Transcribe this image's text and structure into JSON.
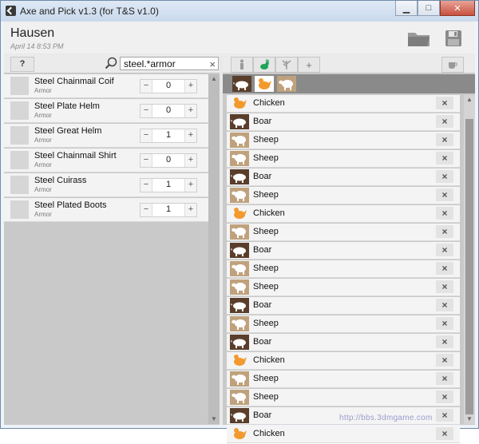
{
  "window": {
    "title": "Axe and Pick v1.3 (for T&S v1.0)"
  },
  "header": {
    "settlement": "Hausen",
    "date": "April 14 8:53 PM"
  },
  "left_toolbar": {
    "help_label": "?",
    "search_value": "steel.*armor",
    "clear_label": "×"
  },
  "items": [
    {
      "name": "Steel Chainmail Coif",
      "category": "Armor",
      "qty": "0"
    },
    {
      "name": "Steel Plate Helm",
      "category": "Armor",
      "qty": "0"
    },
    {
      "name": "Steel Great Helm",
      "category": "Armor",
      "qty": "1"
    },
    {
      "name": "Steel Chainmail Shirt",
      "category": "Armor",
      "qty": "0"
    },
    {
      "name": "Steel Cuirass",
      "category": "Armor",
      "qty": "1"
    },
    {
      "name": "Steel Plated Boots",
      "category": "Armor",
      "qty": "1"
    }
  ],
  "stepper": {
    "minus": "−",
    "plus": "+"
  },
  "right_toolbar": {
    "add_label": "+"
  },
  "animals": [
    {
      "kind": "chicken",
      "name": "Chicken"
    },
    {
      "kind": "boar",
      "name": "Boar"
    },
    {
      "kind": "sheep",
      "name": "Sheep"
    },
    {
      "kind": "sheep",
      "name": "Sheep"
    },
    {
      "kind": "boar",
      "name": "Boar"
    },
    {
      "kind": "sheep",
      "name": "Sheep"
    },
    {
      "kind": "chicken",
      "name": "Chicken"
    },
    {
      "kind": "sheep",
      "name": "Sheep"
    },
    {
      "kind": "boar",
      "name": "Boar"
    },
    {
      "kind": "sheep",
      "name": "Sheep"
    },
    {
      "kind": "sheep",
      "name": "Sheep"
    },
    {
      "kind": "boar",
      "name": "Boar"
    },
    {
      "kind": "sheep",
      "name": "Sheep"
    },
    {
      "kind": "boar",
      "name": "Boar"
    },
    {
      "kind": "chicken",
      "name": "Chicken"
    },
    {
      "kind": "sheep",
      "name": "Sheep"
    },
    {
      "kind": "sheep",
      "name": "Sheep"
    },
    {
      "kind": "boar",
      "name": "Boar"
    },
    {
      "kind": "chicken",
      "name": "Chicken"
    }
  ],
  "remove_label": "×",
  "watermark": "http://bbs.3dmgame.com",
  "colors": {
    "chicken": "#f29a2e",
    "boar": "#5a3e2b",
    "sheep": "#bfa27d",
    "rabbit": "#1fa35a"
  }
}
